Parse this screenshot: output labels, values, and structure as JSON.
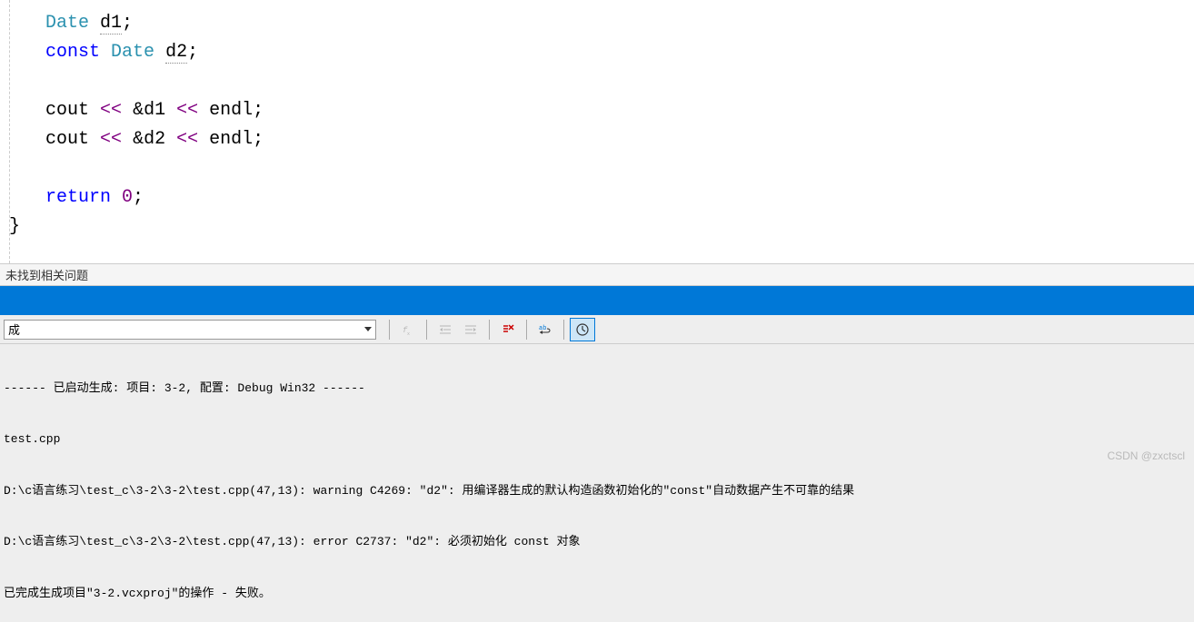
{
  "code": {
    "type_date": "Date",
    "d1": "d1",
    "const_kw": "const",
    "d2": "d2",
    "cout": "cout",
    "lshift": "<<",
    "amp_d1": "&d1",
    "amp_d2": "&d2",
    "endl": "endl",
    "return_kw": "return",
    "zero": "0",
    "semi": ";",
    "rbrace": "}"
  },
  "status": {
    "text": "未找到相关问题"
  },
  "toolbar": {
    "dropdown_value": "成"
  },
  "output": {
    "line1": "------ 已启动生成: 项目: 3-2, 配置: Debug Win32 ------",
    "line2": "test.cpp",
    "line3": "D:\\c语言练习\\test_c\\3-2\\3-2\\test.cpp(47,13): warning C4269: \"d2\": 用编译器生成的默认构造函数初始化的\"const\"自动数据产生不可靠的结果",
    "line4": "D:\\c语言练习\\test_c\\3-2\\3-2\\test.cpp(47,13): error C2737: \"d2\": 必须初始化 const 对象",
    "line5": "已完成生成项目\"3-2.vcxproj\"的操作 - 失败。"
  },
  "watermark": "CSDN @zxctscl"
}
